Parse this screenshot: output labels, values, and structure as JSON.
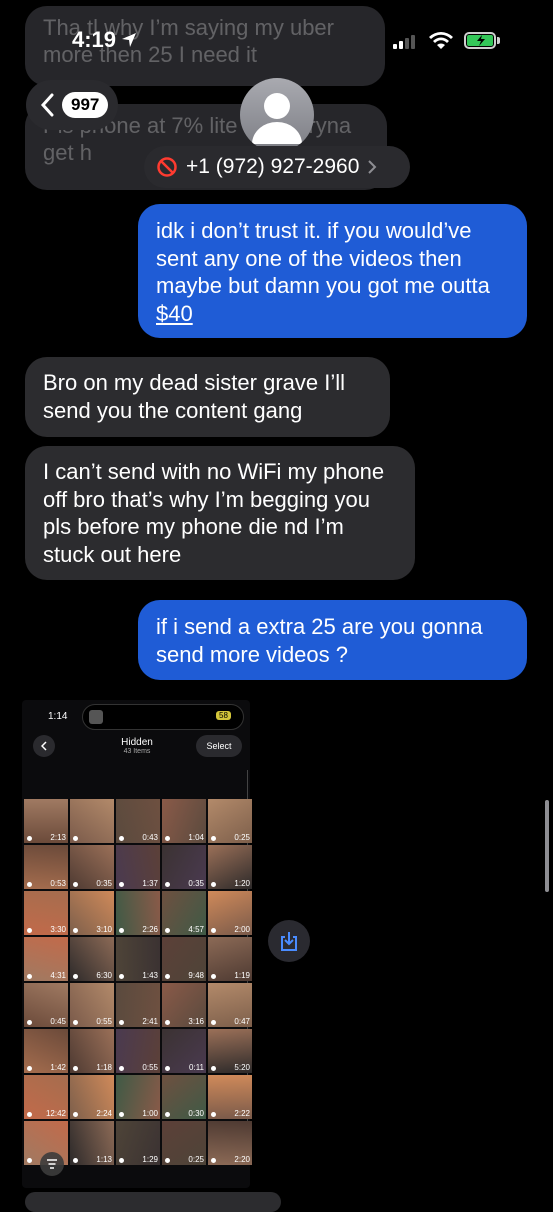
{
  "status_bar": {
    "time": "4:19"
  },
  "faded_messages": [
    {
      "text": "Tha tl  why I’m saying my uber more then 25 I need it"
    },
    {
      "text": "Pls phone at 7% lite    n just tryna get h"
    }
  ],
  "nav": {
    "unread_count": "997",
    "contact": "+1 (972) 927-2960"
  },
  "messages": [
    {
      "dir": "sent",
      "text_before": "idk i don’t trust it. if you would’ve sent any one of the videos then maybe but damn you got me outta ",
      "link": "$40"
    },
    {
      "dir": "received",
      "text": "Bro on my dead sister grave I’ll send you the content gang"
    },
    {
      "dir": "received",
      "text": "I can’t send with no WiFi my phone off bro that’s why I’m begging you pls before my phone die nd I’m stuck out here"
    },
    {
      "dir": "sent",
      "text": "if i send a extra 25 are you gonna send more videos ?"
    }
  ],
  "attached_screenshot": {
    "time": "1:14",
    "battery": "58",
    "album_title": "Hidden",
    "album_count": "43 Items",
    "select_label": "Select",
    "durations": [
      "2:13",
      "",
      "0:43",
      "1:04",
      "0:25",
      "0:53",
      "0:35",
      "1:37",
      "0:35",
      "1:20",
      "3:30",
      "3:10",
      "2:26",
      "4:57",
      "2:00",
      "4:31",
      "6:30",
      "1:43",
      "9:48",
      "1:19",
      "0:45",
      "0:55",
      "2:41",
      "3:16",
      "0:47",
      "1:42",
      "1:18",
      "0:55",
      "0:11",
      "5:20",
      "12:42",
      "2:24",
      "1:00",
      "0:30",
      "2:22",
      "",
      "1:13",
      "1:29",
      "0:25",
      "2:20"
    ]
  },
  "colors": {
    "sent_bubble": "#1f5cd6",
    "received_bubble": "#2c2c2f",
    "battery": "#34c759"
  }
}
